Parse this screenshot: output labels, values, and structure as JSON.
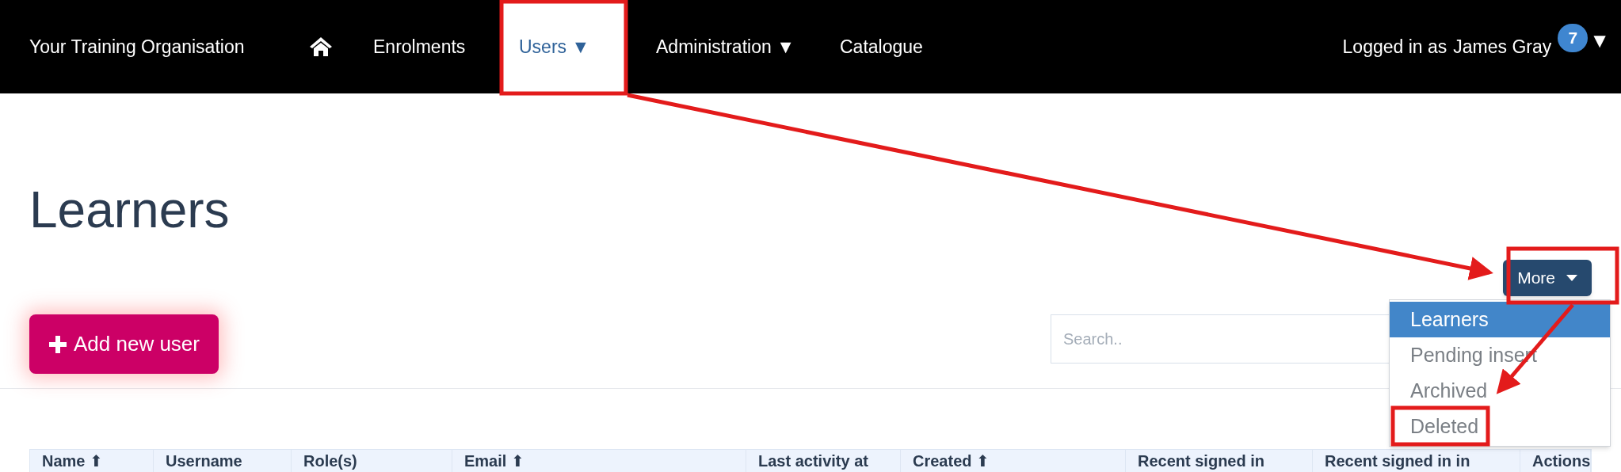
{
  "navbar": {
    "brand": "Your Training Organisation",
    "items": [
      {
        "kind": "icon",
        "selected": false
      },
      {
        "kind": "link",
        "label": "Enrolments",
        "selected": false
      },
      {
        "kind": "menu",
        "label": "Users",
        "caret": "▼",
        "selected": true
      },
      {
        "kind": "menu",
        "label": "Administration",
        "caret": "▼",
        "selected": false
      },
      {
        "kind": "link",
        "label": "Catalogue",
        "selected": false
      }
    ],
    "user": {
      "prefix": "Logged in as",
      "name": "James Gray",
      "badge": "7",
      "caret": "▼"
    }
  },
  "page": {
    "title": "Learners"
  },
  "more_button": {
    "label": "More"
  },
  "more_menu": [
    {
      "label": "Learners",
      "selected": true
    },
    {
      "label": "Pending insert",
      "selected": false
    },
    {
      "label": "Archived",
      "selected": false
    },
    {
      "label": "Deleted",
      "selected": false
    }
  ],
  "add_button": {
    "label": "Add new user"
  },
  "search": {
    "placeholder": "Search.."
  },
  "table": {
    "columns": [
      {
        "label": "Name",
        "sort_icon": "⬆"
      },
      {
        "label": "Username"
      },
      {
        "label": "Role(s)"
      },
      {
        "label": "Email",
        "sort_icon": "⬆"
      },
      {
        "label": "Last activity at"
      },
      {
        "label": "Created",
        "sort_icon": "⬆"
      },
      {
        "label": "Recent signed in"
      },
      {
        "label": "Recent signed in in"
      },
      {
        "label": "Actions"
      }
    ]
  }
}
